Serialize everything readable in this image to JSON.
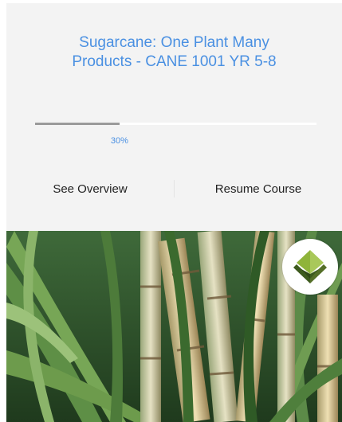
{
  "course": {
    "title_line1": "Sugarcane: One Plant Many",
    "title_line2": "Products - CANE 1001 YR 5-8",
    "progress_percent": 30,
    "progress_label": "30%"
  },
  "actions": {
    "overview_label": "See Overview",
    "resume_label": "Resume Course"
  },
  "colors": {
    "accent": "#4a90e2",
    "card_background": "#f3f3f3",
    "progress_fill": "#9a9a9a",
    "logo_green_dark": "#3d5a1e",
    "logo_green_light": "#8fb43a"
  },
  "icons": {
    "logo": "leaf-emblem-icon"
  }
}
